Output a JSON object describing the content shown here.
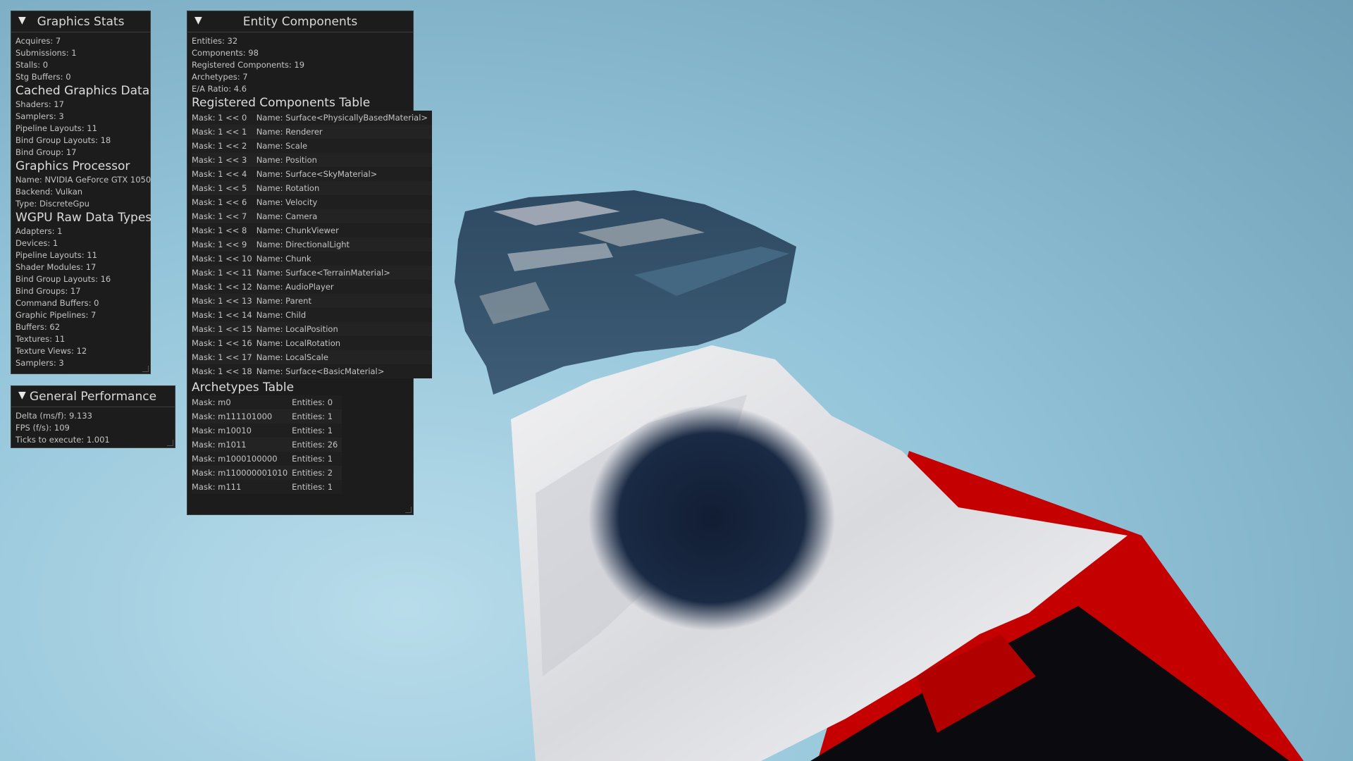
{
  "graphics_stats": {
    "title": "Graphics Stats",
    "lines_a": [
      "Acquires: 7",
      "Submissions: 1",
      "Stalls: 0",
      "Stg Buffers: 0"
    ],
    "cached_heading": "Cached Graphics Data",
    "cached": [
      "Shaders: 17",
      "Samplers: 3",
      "Pipeline Layouts: 11",
      "Bind Group Layouts: 18",
      "Bind Group: 17"
    ],
    "processor_heading": "Graphics Processor",
    "processor": [
      "Name: NVIDIA GeForce GTX 1050",
      "Backend: Vulkan",
      "Type: DiscreteGpu"
    ],
    "wgpu_heading": "WGPU Raw Data Types",
    "wgpu": [
      "Adapters: 1",
      "Devices: 1",
      "Pipeline Layouts: 11",
      "Shader Modules: 17",
      "Bind Group Layouts: 16",
      "Bind Groups: 17",
      "Command Buffers: 0",
      "Graphic Pipelines: 7",
      "Buffers: 62",
      "Textures: 11",
      "Texture Views: 12",
      "Samplers: 3"
    ]
  },
  "general_performance": {
    "title": "General Performance",
    "lines": [
      "Delta (ms/f): 9.133",
      "FPS (f/s): 109",
      "Ticks to execute: 1.001"
    ]
  },
  "entity_components": {
    "title": "Entity Components",
    "stats": [
      "Entities: 32",
      "Components: 98",
      "Registered Components: 19",
      "Archetypes: 7",
      "E/A Ratio: 4.6"
    ],
    "registered_heading": "Registered Components Table",
    "registered": [
      {
        "mask": "Mask: 1 << 0",
        "name": "Name: Surface<PhysicallyBasedMaterial>"
      },
      {
        "mask": "Mask: 1 << 1",
        "name": "Name: Renderer"
      },
      {
        "mask": "Mask: 1 << 2",
        "name": "Name: Scale"
      },
      {
        "mask": "Mask: 1 << 3",
        "name": "Name: Position"
      },
      {
        "mask": "Mask: 1 << 4",
        "name": "Name: Surface<SkyMaterial>"
      },
      {
        "mask": "Mask: 1 << 5",
        "name": "Name: Rotation"
      },
      {
        "mask": "Mask: 1 << 6",
        "name": "Name: Velocity"
      },
      {
        "mask": "Mask: 1 << 7",
        "name": "Name: Camera"
      },
      {
        "mask": "Mask: 1 << 8",
        "name": "Name: ChunkViewer"
      },
      {
        "mask": "Mask: 1 << 9",
        "name": "Name: DirectionalLight"
      },
      {
        "mask": "Mask: 1 << 10",
        "name": "Name: Chunk"
      },
      {
        "mask": "Mask: 1 << 11",
        "name": "Name: Surface<TerrainMaterial>"
      },
      {
        "mask": "Mask: 1 << 12",
        "name": "Name: AudioPlayer"
      },
      {
        "mask": "Mask: 1 << 13",
        "name": "Name: Parent"
      },
      {
        "mask": "Mask: 1 << 14",
        "name": "Name: Child"
      },
      {
        "mask": "Mask: 1 << 15",
        "name": "Name: LocalPosition"
      },
      {
        "mask": "Mask: 1 << 16",
        "name": "Name: LocalRotation"
      },
      {
        "mask": "Mask: 1 << 17",
        "name": "Name: LocalScale"
      },
      {
        "mask": "Mask: 1 << 18",
        "name": "Name: Surface<BasicMaterial>"
      }
    ],
    "archetypes_heading": "Archetypes Table",
    "archetypes": [
      {
        "mask": "Mask: m0",
        "entities": "Entities: 0"
      },
      {
        "mask": "Mask: m111101000",
        "entities": "Entities: 1"
      },
      {
        "mask": "Mask: m10010",
        "entities": "Entities: 1"
      },
      {
        "mask": "Mask: m1011",
        "entities": "Entities: 26"
      },
      {
        "mask": "Mask: m1000100000",
        "entities": "Entities: 1"
      },
      {
        "mask": "Mask: m110000001010",
        "entities": "Entities: 2"
      },
      {
        "mask": "Mask: m111",
        "entities": "Entities: 1"
      }
    ]
  },
  "colors": {
    "panel_bg": "#1c1c1c",
    "sky": "#9cc8dc",
    "terrain_light": "#e8e8ec",
    "terrain_dark": "#152238",
    "accent_red": "#c20000",
    "rock": "#35526a"
  }
}
